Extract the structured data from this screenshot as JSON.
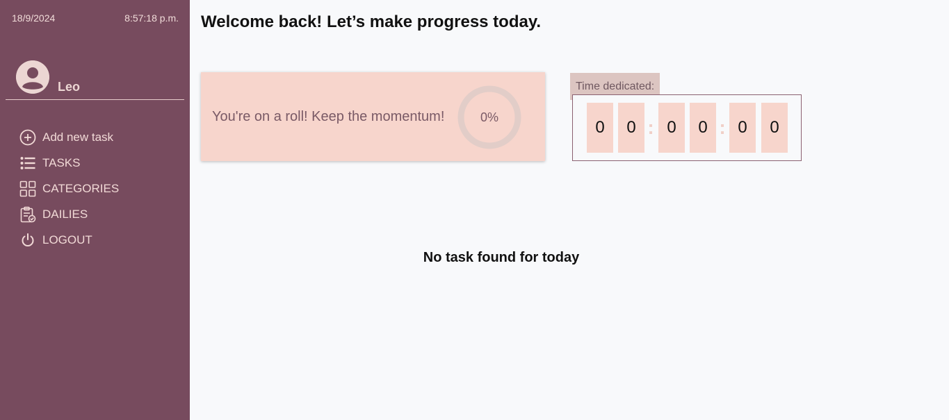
{
  "sidebar": {
    "date": "18/9/2024",
    "time": "8:57:18 p.m.",
    "user": {
      "name": "Leo"
    },
    "items": [
      {
        "label": "Add new task",
        "icon": "plus-circle-icon"
      },
      {
        "label": "TASKS",
        "icon": "list-icon"
      },
      {
        "label": "CATEGORIES",
        "icon": "grid-icon"
      },
      {
        "label": "DAILIES",
        "icon": "clipboard-check-icon"
      },
      {
        "label": "LOGOUT",
        "icon": "power-icon"
      }
    ]
  },
  "main": {
    "title": "Welcome back! Let’s make progress today.",
    "progress": {
      "message": "You're on a roll! Keep the momentum!",
      "percent_label": "0%",
      "percent_value": 0
    },
    "timer": {
      "label": "Time dedicated:",
      "digits": [
        "0",
        "0",
        "0",
        "0",
        "0",
        "0"
      ],
      "separator": ":"
    },
    "empty_message": "No task found for today"
  },
  "colors": {
    "sidebar_bg": "#774b5e",
    "accent_pink": "#f7d5cc",
    "label_bg": "#dcc5c1",
    "ring": "#e2cdc8"
  }
}
